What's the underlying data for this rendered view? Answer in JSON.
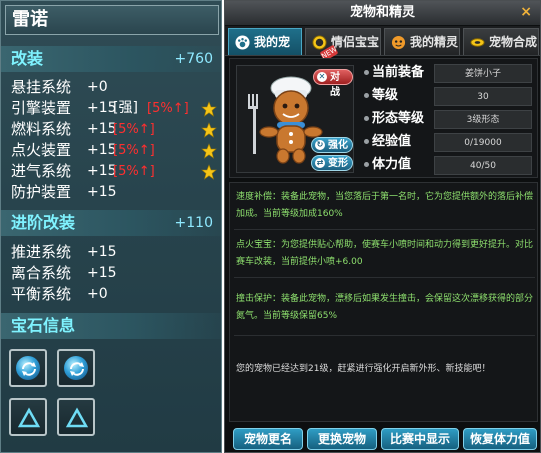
{
  "left": {
    "name": "雷诺",
    "mod_section": {
      "title": "改装",
      "total": "+760"
    },
    "mods": [
      {
        "label": "悬挂系统",
        "value": "+0",
        "tag": "",
        "pct": "",
        "star": false
      },
      {
        "label": "引擎装置",
        "value": "+15",
        "tag": "[强]",
        "pct": "[5%↑]",
        "star": true
      },
      {
        "label": "燃料系统",
        "value": "+15",
        "tag": "",
        "pct": "[5%↑]",
        "star": true
      },
      {
        "label": "点火装置",
        "value": "+15",
        "tag": "",
        "pct": "[5%↑]",
        "star": true
      },
      {
        "label": "进气系统",
        "value": "+15",
        "tag": "",
        "pct": "[5%↑]",
        "star": true
      },
      {
        "label": "防护装置",
        "value": "+15",
        "tag": "",
        "pct": "",
        "star": false
      }
    ],
    "adv_section": {
      "title": "进阶改装",
      "total": "+110"
    },
    "adv_mods": [
      {
        "label": "推进系统",
        "value": "+15"
      },
      {
        "label": "离合系统",
        "value": "+15"
      },
      {
        "label": "平衡系统",
        "value": "+0"
      }
    ],
    "gem_section": {
      "title": "宝石信息"
    },
    "colors": {
      "section_text": "#7ff3ff",
      "pct_text": "#ff2f2f",
      "star": "#f5c518"
    }
  },
  "right": {
    "title": "宠物和精灵",
    "close": "×",
    "tabs": [
      {
        "label": "我的宠物",
        "active": true,
        "icon": "paw-icon"
      },
      {
        "label": "情侣宝宝",
        "active": false,
        "icon": "baby-icon"
      },
      {
        "label": "我的精灵",
        "active": false,
        "icon": "sprite-icon"
      },
      {
        "label": "宠物合成",
        "active": false,
        "icon": "synthesis-icon"
      }
    ],
    "new_badge": "NEW",
    "pet_buttons": {
      "battle": "对战",
      "strengthen": "强化",
      "transform": "变形"
    },
    "stats": [
      {
        "label": "当前装备",
        "value": "姜饼小子"
      },
      {
        "label": "等级",
        "value": "30"
      },
      {
        "label": "形态等级",
        "value": "3级形态"
      },
      {
        "label": "经验值",
        "value": "0/19000"
      },
      {
        "label": "体力值",
        "value": "40/50"
      }
    ],
    "skills": [
      {
        "text": "速度补偿：装备此宠物，当您落后于第一名时，它为您提供额外的落后补偿加成。当前等级加成160%"
      },
      {
        "text": "点火宝宝：为您提供贴心帮助，使赛车小喷时间和动力得到更好提升。对比赛车改装，当前提供小喷+6.00"
      },
      {
        "text": "撞击保护：装备此宠物，漂移后如果发生撞击，会保留这次漂移获得的部分氮气。当前等级保留65%"
      }
    ],
    "note": "您的宠物已经达到21级，赶紧进行强化开启新外形、新技能吧！",
    "buttons": [
      "宠物更名",
      "更换宠物",
      "比赛中显示",
      "恢复体力值"
    ],
    "colors": {
      "accent": "#1f6f8a",
      "skill_text": "#8ee06e",
      "close": "#f0b23a"
    }
  }
}
